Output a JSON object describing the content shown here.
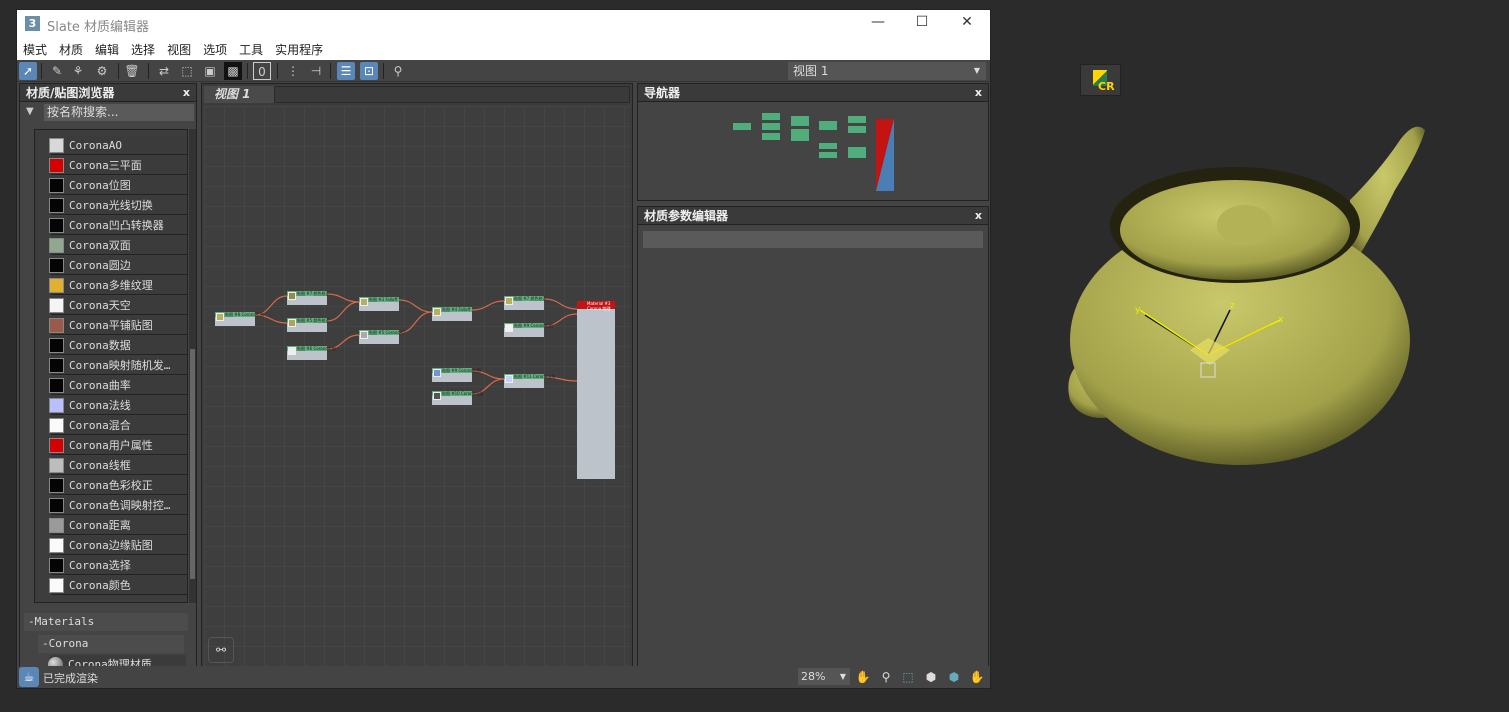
{
  "window": {
    "title": "Slate 材质编辑器",
    "logo": "3",
    "minimize": "—",
    "maximize": "☐",
    "close": "✕"
  },
  "menu": [
    "模式",
    "材质",
    "编辑",
    "选择",
    "视图",
    "选项",
    "工具",
    "实用程序"
  ],
  "toolbar": {
    "view_select": "视图 1",
    "font_icon": "0"
  },
  "browser": {
    "title": "材质/贴图浏览器",
    "close": "x",
    "search_placeholder": "按名称搜索...",
    "items": [
      {
        "label": "CoronaAO",
        "color": "#d8d8d8"
      },
      {
        "label": "Corona三平面",
        "color": "#d40000"
      },
      {
        "label": "Corona位图",
        "color": "#050505"
      },
      {
        "label": "Corona光线切换",
        "color": "#050505"
      },
      {
        "label": "Corona凹凸转换器",
        "color": "#050505"
      },
      {
        "label": "Corona双面",
        "color": "#8fa88f"
      },
      {
        "label": "Corona圆边",
        "color": "#050505"
      },
      {
        "label": "Corona多维纹理",
        "color": "#e0b030"
      },
      {
        "label": "Corona天空",
        "color": "#f4f4f4"
      },
      {
        "label": "Corona平铺贴图",
        "color": "#9a5a4a"
      },
      {
        "label": "Corona数据",
        "color": "#050505"
      },
      {
        "label": "Corona映射随机发…",
        "color": "#050505"
      },
      {
        "label": "Corona曲率",
        "color": "#050505"
      },
      {
        "label": "Corona法线",
        "color": "#b8c0ff"
      },
      {
        "label": "Corona混合",
        "color": "#fafafa"
      },
      {
        "label": "Corona用户属性",
        "color": "#d40000"
      },
      {
        "label": "Corona线框",
        "color": "#bdbdbd"
      },
      {
        "label": "Corona色彩校正",
        "color": "#050505"
      },
      {
        "label": "Corona色调映射控…",
        "color": "#050505"
      },
      {
        "label": "Corona距离",
        "color": "#9a9a9a"
      },
      {
        "label": "Corona边缘贴图",
        "color": "#fafafa"
      },
      {
        "label": "Corona选择",
        "color": "#050505"
      },
      {
        "label": "Corona颜色",
        "color": "#fafafa"
      }
    ],
    "group_materials": "-Materials",
    "group_corona": "-Corona",
    "material_item": "Corona物理材质"
  },
  "view": {
    "tab": "视图 1",
    "nodes": [
      {
        "title": "贴图 #8",
        "sub": "Corona位图",
        "color": "#b5b060"
      },
      {
        "title": "贴图 #7",
        "sub": "颜色校正",
        "color": "#8d8f45"
      },
      {
        "title": "贴图 #5",
        "sub": "颜色校正",
        "color": "#a9a65a"
      },
      {
        "title": "贴图 #6",
        "sub": "Corona位图",
        "color": "#eeeeee"
      },
      {
        "title": "贴图 #3",
        "sub": "Falloff",
        "color": "#b5b060"
      },
      {
        "title": "贴图 #5",
        "sub": "CoronaAO",
        "color": "#aaaaaa"
      },
      {
        "title": "贴图 #4",
        "sub": "Falloff",
        "color": "#b5b060"
      },
      {
        "title": "贴图 #7",
        "sub": "颜色校正",
        "color": "#b5b060"
      },
      {
        "title": "贴图 #9",
        "sub": "Corona位图",
        "color": "#f2f2f2"
      },
      {
        "title": "贴图 #9",
        "sub": "Corona位图",
        "color": "#6f95d8"
      },
      {
        "title": "贴图 #10",
        "sub": "Corona位图",
        "color": "#555555"
      },
      {
        "title": "贴图 #11",
        "sub": "Corona法线",
        "color": "#c5d0ff"
      }
    ],
    "material": {
      "title": "Material #3",
      "sub": "Corona 物理"
    }
  },
  "navigator": {
    "title": "导航器",
    "close": "x"
  },
  "params": {
    "title": "材质参数编辑器",
    "close": "x"
  },
  "status": {
    "text": "已完成渲染",
    "zoom": "28%"
  },
  "viewport": {
    "badge": "CR",
    "axes": {
      "x": "x",
      "y": "y",
      "z": "z"
    },
    "teapot_color": "#b4b455"
  }
}
